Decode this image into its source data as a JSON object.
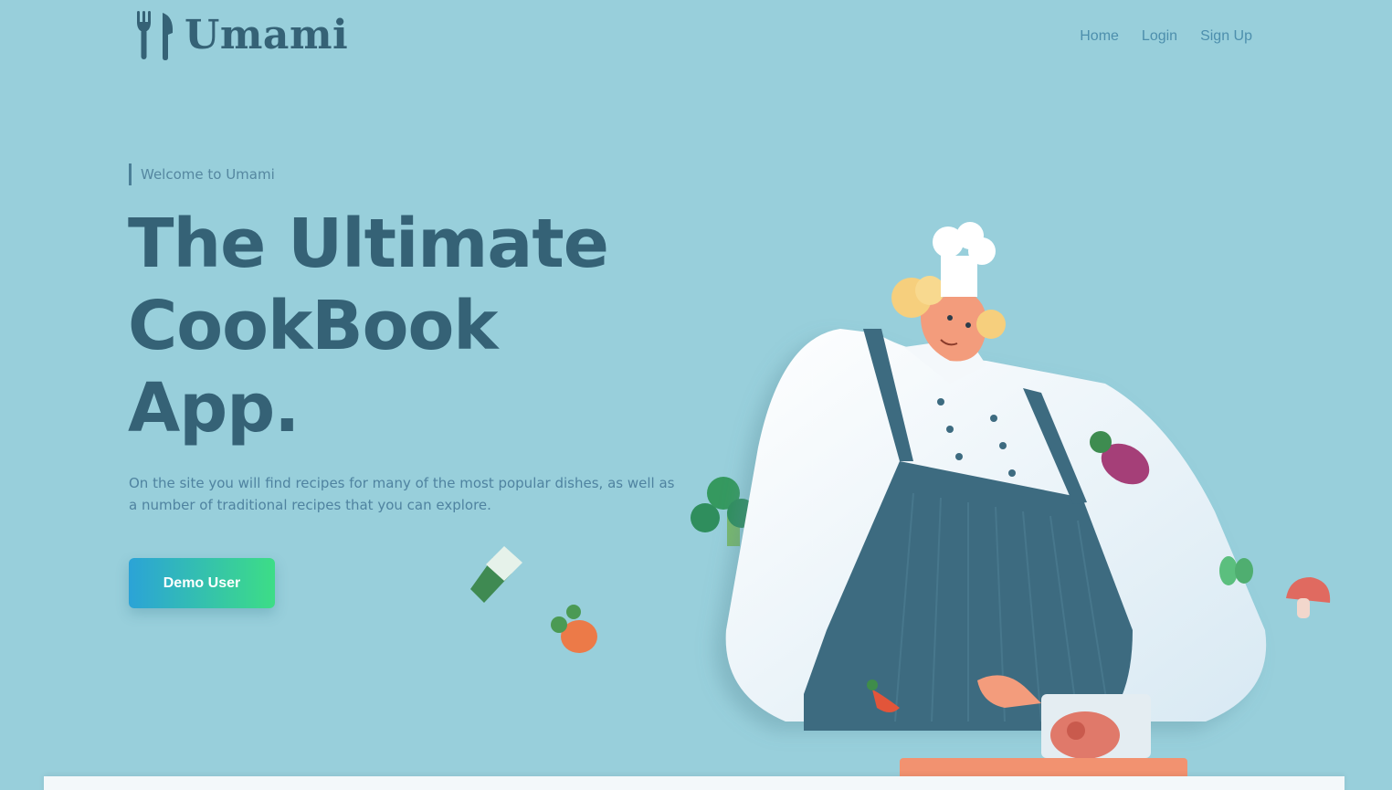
{
  "header": {
    "logo_text": "Umami",
    "logo_icon": "fork-knife-icon",
    "nav": [
      {
        "label": "Home"
      },
      {
        "label": "Login"
      },
      {
        "label": "Sign Up"
      }
    ]
  },
  "hero": {
    "eyebrow": "Welcome to Umami",
    "headline": [
      "The Ultimate",
      "CookBook",
      "App."
    ],
    "description": "On the site you will find recipes for many of the most popular dishes, as well as a number of traditional recipes that you can explore.",
    "cta_label": "Demo User"
  },
  "illustration": {
    "subject": "chef-illustration"
  },
  "colors": {
    "background": "#98cfdb",
    "heading": "#356276",
    "nav_link": "#4d8fad",
    "button_gradient_start": "#2ba3d7",
    "button_gradient_end": "#3ddd86"
  }
}
